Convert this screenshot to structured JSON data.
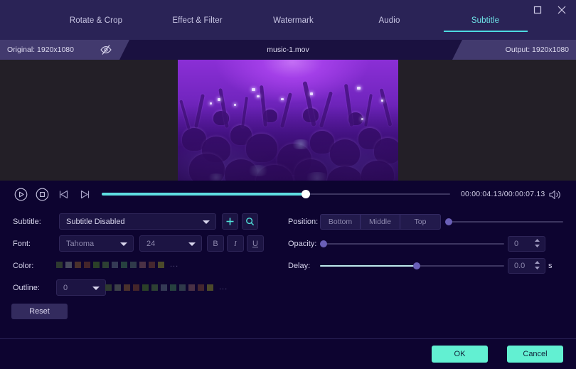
{
  "window": {
    "maximize_icon": "maximize-icon",
    "close_icon": "close-icon"
  },
  "tabs": [
    {
      "label": "Rotate & Crop",
      "active": false
    },
    {
      "label": "Effect & Filter",
      "active": false
    },
    {
      "label": "Watermark",
      "active": false
    },
    {
      "label": "Audio",
      "active": false
    },
    {
      "label": "Subtitle",
      "active": true
    }
  ],
  "infobar": {
    "original": "Original: 1920x1080",
    "output": "Output: 1920x1080",
    "filename": "music-1.mov",
    "preview_toggle_icon": "eye-slash-icon"
  },
  "player": {
    "play_icon": "play-circle-icon",
    "stop_icon": "stop-circle-icon",
    "prev_frame_icon": "previous-frame-icon",
    "next_frame_icon": "next-frame-icon",
    "volume_icon": "volume-icon",
    "timecode": "00:00:04.13/00:00:07.13",
    "current_time": "00:00:04.13",
    "total_time": "00:00:07.13",
    "progress_percent": 59
  },
  "subtitle": {
    "subtitle_label": "Subtitle:",
    "subtitle_value": "Subtitle Disabled",
    "add_icon": "plus-icon",
    "search_icon": "search-icon",
    "font_label": "Font:",
    "font_value": "Tahoma",
    "font_size_value": "24",
    "bold_label": "B",
    "italic_label": "I",
    "underline_label": "U",
    "color_label": "Color:",
    "color_more": "...",
    "color_swatches": [
      "#2e3a30",
      "#474a5c",
      "#4a312c",
      "#44252a",
      "#2b4028",
      "#2d4033",
      "#343a55",
      "#26413f",
      "#2f3a4a",
      "#4a3145",
      "#44272f",
      "#4c4a2a"
    ],
    "outline_label": "Outline:",
    "outline_value": "0",
    "outline_more": "...",
    "outline_swatches": [
      "#2e3a30",
      "#3c4048",
      "#4a312c",
      "#44252a",
      "#2b4028",
      "#2d4033",
      "#343a55",
      "#26413f",
      "#2f3a4a",
      "#4a3145",
      "#44272f",
      "#4c4a2a"
    ],
    "reset_label": "Reset"
  },
  "right": {
    "position_label": "Position:",
    "position_options": [
      "Bottom",
      "Middle",
      "Top"
    ],
    "position_slider_percent": 2,
    "opacity_label": "Opacity:",
    "opacity_value": "0",
    "opacity_slider_percent": 1,
    "delay_label": "Delay:",
    "delay_value": "0.0",
    "delay_unit": "s",
    "delay_slider_percent": 53
  },
  "footer": {
    "ok_label": "OK",
    "cancel_label": "Cancel"
  },
  "colors": {
    "accent": "#4ddbe0",
    "button": "#62f0d2",
    "background": "#0d0430",
    "titlebar": "#2a2356"
  }
}
